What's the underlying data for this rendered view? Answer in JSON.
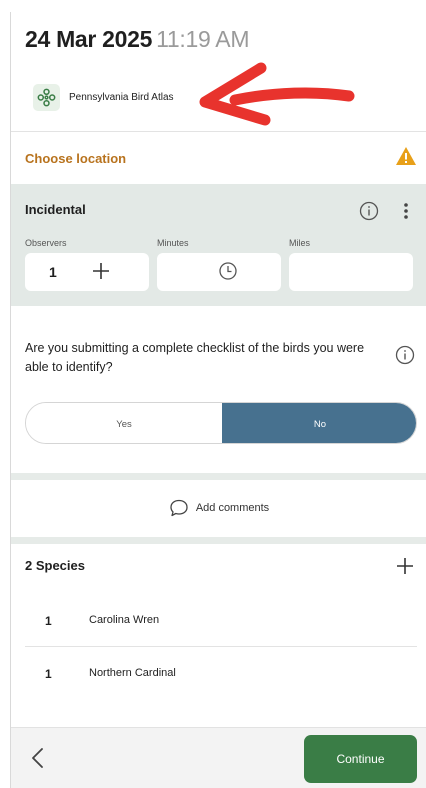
{
  "header": {
    "date": "24 Mar 2025",
    "time": "11:19 AM",
    "portal_name": "Pennsylvania Bird Atlas"
  },
  "location": {
    "label": "Choose location",
    "warning_icon": "warning-triangle-icon"
  },
  "protocol": {
    "name": "Incidental",
    "fields": {
      "observers_label": "Observers",
      "observers_value": "1",
      "minutes_label": "Minutes",
      "miles_label": "Miles"
    }
  },
  "complete": {
    "question": "Are you submitting a complete checklist of the birds you were able to identify?",
    "yes_label": "Yes",
    "no_label": "No",
    "selected": "No"
  },
  "comments": {
    "label": "Add comments"
  },
  "species": {
    "title": "2 Species",
    "items": [
      {
        "count": "1",
        "name": "Carolina Wren"
      },
      {
        "count": "1",
        "name": "Northern Cardinal"
      }
    ]
  },
  "footer": {
    "continue_label": "Continue"
  },
  "colors": {
    "accent_orange": "#b8731e",
    "toggle_selected": "#47718f",
    "continue_green": "#3a7d46",
    "annotation_red": "#e8332d"
  }
}
